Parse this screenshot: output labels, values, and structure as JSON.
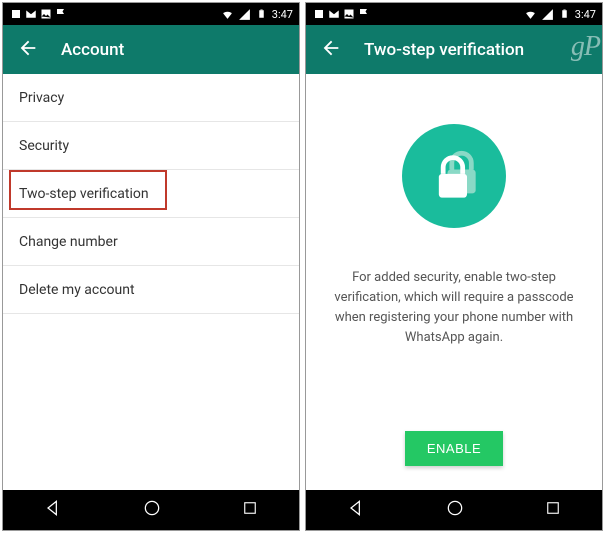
{
  "status": {
    "time": "3:47"
  },
  "left": {
    "title": "Account",
    "items": [
      "Privacy",
      "Security",
      "Two-step verification",
      "Change number",
      "Delete my account"
    ],
    "highlightIndex": 2
  },
  "right": {
    "title": "Two-step verification",
    "watermark": "gP",
    "description": "For added security, enable two-step verification, which will require a passcode when registering your phone number with WhatsApp again.",
    "enableLabel": "ENABLE"
  }
}
